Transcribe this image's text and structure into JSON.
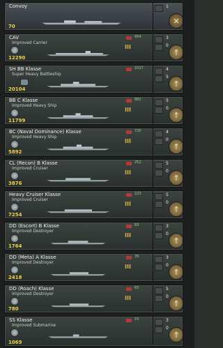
{
  "rows": [
    {
      "name": "Convoy",
      "sub": "",
      "cost": "70",
      "flag": false,
      "stat": "",
      "rank": "",
      "cnt1": "1",
      "cnt2": "",
      "action": "✕"
    },
    {
      "name": "CAV",
      "sub": "Improved Carrier",
      "cost": "12290",
      "flag": true,
      "stat": "954",
      "rank": "III",
      "cnt1": "3",
      "cnt2": "0",
      "action": "↑"
    },
    {
      "name": "SH BB Klasse",
      "sub": "Super Heavy Battleship",
      "cost": "20104",
      "flag": true,
      "stat": "1027",
      "rank": "",
      "cnt1": "4",
      "cnt2": "5",
      "action": "↑"
    },
    {
      "name": "BB C Klasse",
      "sub": "Improved Heavy Ship",
      "cost": "11799",
      "flag": true,
      "stat": "882",
      "rank": "III",
      "cnt1": "5",
      "cnt2": "0",
      "action": "↑"
    },
    {
      "name": "BC (Naval Dominance) Klasse",
      "sub": "Improved Heavy Ship",
      "cost": "5892",
      "flag": true,
      "stat": "720",
      "rank": "III",
      "cnt1": "4",
      "cnt2": "0",
      "action": "↑"
    },
    {
      "name": "CL (Recon) B Klasse",
      "sub": "Improved Cruiser",
      "cost": "3876",
      "flag": true,
      "stat": "252",
      "rank": "III",
      "cnt1": "5",
      "cnt2": "0",
      "action": "↑"
    },
    {
      "name": "Heavy Cruiser Klasse",
      "sub": "Improved Cruiser",
      "cost": "7254",
      "flag": true,
      "stat": "223",
      "rank": "III",
      "cnt1": "5",
      "cnt2": "0",
      "action": "↑"
    },
    {
      "name": "DD (Escort) B Klasse",
      "sub": "Improved Destroyer",
      "cost": "1764",
      "flag": true,
      "stat": "83",
      "rank": "III",
      "cnt1": "3",
      "cnt2": "0",
      "action": "↑"
    },
    {
      "name": "DD (Meta) A Klasse",
      "sub": "Improved Destroyer",
      "cost": "2418",
      "flag": true,
      "stat": "39",
      "rank": "III",
      "cnt1": "3",
      "cnt2": "0",
      "action": "↑"
    },
    {
      "name": "DD (Roach) Klasse",
      "sub": "Improved Destroyer",
      "cost": "780",
      "flag": true,
      "stat": "65",
      "rank": "III",
      "cnt1": "5",
      "cnt2": "0",
      "action": "↑"
    },
    {
      "name": "SS Klasse",
      "sub": "Improved Submarine",
      "cost": "1069",
      "flag": true,
      "stat": "15",
      "rank": "",
      "cnt1": "3",
      "cnt2": "0",
      "action": "↑"
    }
  ]
}
